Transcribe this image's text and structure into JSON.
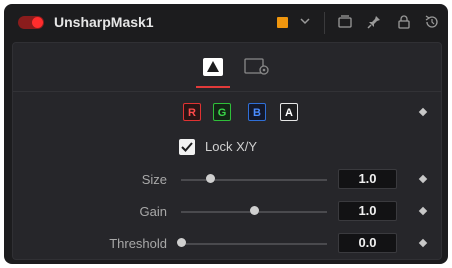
{
  "header": {
    "title": "UnsharpMask1",
    "toggle_state": "on",
    "node_color": "#f0960e"
  },
  "tabs": [
    {
      "name": "controls",
      "icon": "triangle-icon",
      "active": true
    },
    {
      "name": "settings",
      "icon": "settings-icon",
      "active": false
    }
  ],
  "channels": [
    "R",
    "G",
    "B",
    "A"
  ],
  "lock": {
    "label": "Lock X/Y",
    "checked": true
  },
  "params": [
    {
      "label": "Size",
      "value": "1.0",
      "slider_fraction": 0.2
    },
    {
      "label": "Gain",
      "value": "1.0",
      "slider_fraction": 0.5
    },
    {
      "label": "Threshold",
      "value": "0.0",
      "slider_fraction": 0.0
    }
  ],
  "colors": {
    "accent_red": "#e23a3a",
    "channel_r": "#e03232",
    "channel_g": "#2fbf3a",
    "channel_b": "#2f6fd8"
  }
}
